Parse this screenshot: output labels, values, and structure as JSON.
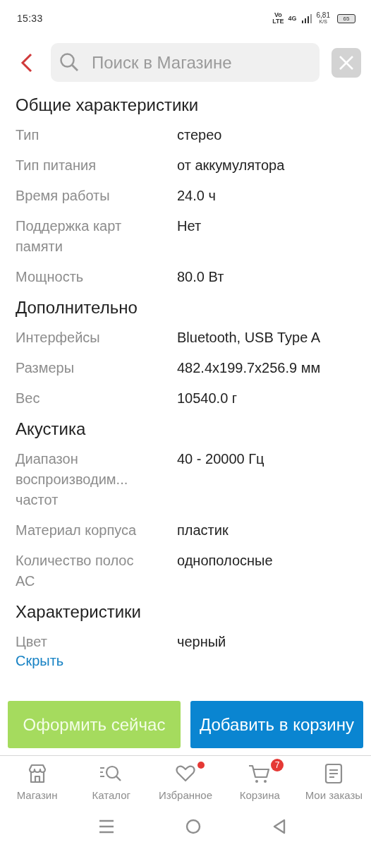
{
  "status_bar": {
    "time": "15:33",
    "volte_top": "Vo",
    "volte_bottom": "LTE",
    "network": "4G",
    "speed": "6,81",
    "speed_unit": "K/S",
    "battery": "65"
  },
  "search": {
    "placeholder": "Поиск в Магазине"
  },
  "sections": [
    {
      "title": "Общие характеристики",
      "rows": [
        {
          "label": "Тип",
          "value": "стерео"
        },
        {
          "label": "Тип питания",
          "value": "от аккумулятора"
        },
        {
          "label": "Время работы",
          "value": "24.0 ч"
        },
        {
          "label": "Поддержка карт памяти",
          "value": "Нет"
        },
        {
          "label": "Мощность",
          "value": "80.0 Вт"
        }
      ]
    },
    {
      "title": "Дополнительно",
      "rows": [
        {
          "label": "Интерфейсы",
          "value": "Bluetooth, USB Type A"
        },
        {
          "label": "Размеры",
          "value": "482.4x199.7x256.9 мм"
        },
        {
          "label": "Вес",
          "value": "10540.0 г"
        }
      ]
    },
    {
      "title": "Акустика",
      "rows": [
        {
          "label": "Диапазон воспроизводим... частот",
          "value": "40 - 20000 Гц"
        },
        {
          "label": "Материал корпуса",
          "value": "пластик"
        },
        {
          "label": "Количество полос АС",
          "value": "однополосные"
        }
      ]
    },
    {
      "title": "Характеристики",
      "rows": [
        {
          "label": "Цвет",
          "value": "черный"
        }
      ]
    }
  ],
  "hide_link": "Скрыть",
  "buttons": [
    {
      "kind": "checkout",
      "label": "Оформить сейчас"
    },
    {
      "kind": "cart",
      "label": "Добавить в корзину"
    }
  ],
  "nav": [
    {
      "label": "Магазин",
      "dot": false
    },
    {
      "label": "Каталог",
      "dot": false
    },
    {
      "label": "Избранное",
      "dot": true
    },
    {
      "label": "Корзина",
      "dot": false,
      "badge": "7"
    },
    {
      "label": "Мои заказы",
      "dot": false
    }
  ]
}
